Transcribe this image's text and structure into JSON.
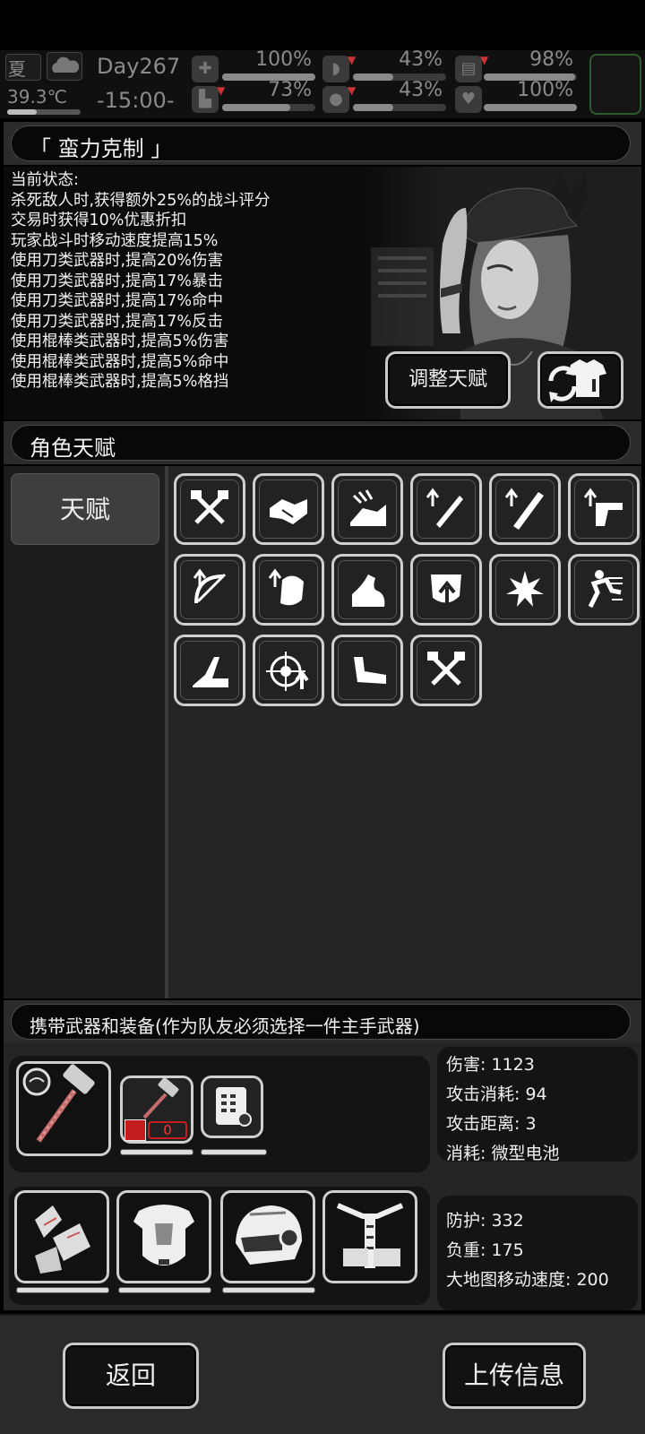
{
  "hud": {
    "season": "夏",
    "temperature": "39.3℃",
    "day": "Day267",
    "time": "-15:00-",
    "stats": [
      {
        "icon": "medkit-icon",
        "value": "100%",
        "level": 1.0
      },
      {
        "icon": "stomach-icon",
        "value": "43%",
        "level": 0.43
      },
      {
        "icon": "battery-icon",
        "value": "98%",
        "level": 0.98
      },
      {
        "icon": "boot-icon",
        "value": "73%",
        "level": 0.73
      },
      {
        "icon": "water-drop-icon",
        "value": "43%",
        "level": 0.43
      },
      {
        "icon": "heart-icon",
        "value": "100%",
        "level": 1.0
      }
    ]
  },
  "talent": {
    "title": "「 蛮力克制 」",
    "status_label": "当前状态:",
    "effects": [
      "杀死敌人时,获得额外25%的战斗评分",
      "交易时获得10%优惠折扣",
      "玩家战斗时移动速度提高15%",
      "使用刀类武器时,提高20%伤害",
      "使用刀类武器时,提高17%暴击",
      "使用刀类武器时,提高17%命中",
      "使用刀类武器时,提高17%反击",
      "使用棍棒类武器时,提高5%伤害",
      "使用棍棒类武器时,提高5%命中",
      "使用棍棒类武器时,提高5%格挡"
    ],
    "adjust_button": "调整天赋"
  },
  "role_talent": {
    "title": "角色天赋",
    "tab": "天赋",
    "icons": [
      "crossed-axes-icon",
      "handshake-icon",
      "sprint-icon",
      "knife-up-icon",
      "bat-up-icon",
      "pistol-up-icon",
      "crossbow-up-icon",
      "fist-up-icon",
      "flexed-arm-icon",
      "shield-up-icon",
      "explosion-icon",
      "running-man-icon",
      "dodge-icon",
      "target-up-icon",
      "kick-icon",
      "crossed-axes-icon"
    ]
  },
  "equipment": {
    "title": "携带武器和装备(作为队友必须选择一件主手武器)",
    "ammo_count": "0",
    "weapon_stats": [
      "伤害: 1123",
      "攻击消耗: 94",
      "攻击距离: 3",
      "消耗: 微型电池"
    ],
    "armor_stats": [
      "防护: 332",
      "负重: 175",
      "大地图移动速度: 200"
    ]
  },
  "bottom": {
    "back": "返回",
    "upload": "上传信息"
  }
}
